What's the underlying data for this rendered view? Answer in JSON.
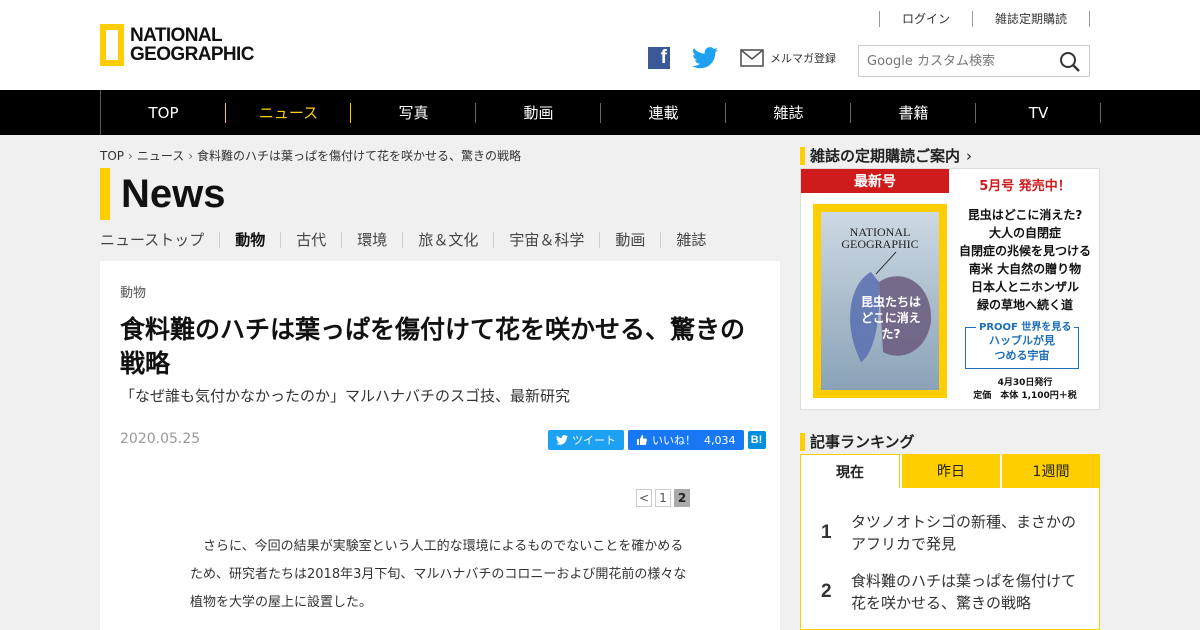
{
  "header": {
    "logo": {
      "line1": "NATIONAL",
      "line2": "GEOGRAPHIC"
    },
    "top_links": [
      "ログイン",
      "雑誌定期購読"
    ],
    "newsletter_label": "メルマガ登録",
    "search_placeholder": "Google カスタム検索",
    "brand_color": "#ffce00"
  },
  "nav": {
    "items": [
      "TOP",
      "ニュース",
      "写真",
      "動画",
      "連載",
      "雑誌",
      "書籍",
      "TV"
    ],
    "active": "ニュース"
  },
  "breadcrumb": [
    "TOP",
    "ニュース",
    "食料難のハチは葉っぱを傷付けて花を咲かせる、驚きの戦略"
  ],
  "section": {
    "title": "News"
  },
  "subnav": {
    "items": [
      "ニューストップ",
      "動物",
      "古代",
      "環境",
      "旅＆文化",
      "宇宙＆科学",
      "動画",
      "雑誌"
    ],
    "active": "動物"
  },
  "article": {
    "category": "動物",
    "headline": "食料難のハチは葉っぱを傷付けて花を咲かせる、驚きの戦略",
    "subtitle": "「なぜ誰も気付かなかったのか」マルハナバチのスゴ技、最新研究",
    "date": "2020.05.25",
    "share": {
      "tweet": "ツイート",
      "like": "いいね！",
      "like_count": "4,034",
      "hatena": "B!"
    },
    "pager": {
      "prev": "<",
      "pages": [
        "1",
        "2"
      ],
      "current": "2"
    },
    "body": "さらに、今回の結果が実験室という人工的な環境によるものでないことを確かめるため、研究者たちは2018年3月下旬、マルハナバチのコロニーおよび開花前の様々な植物を大学の屋上に設置した。"
  },
  "sidebar": {
    "magazine": {
      "heading": "雑誌の定期購読ご案内",
      "latest_label": "最新号",
      "issue_label": "5月号 発売中！",
      "cover_brand": "NATIONAL GEOGRAPHIC",
      "cover_title": "昆虫たちはどこに消えた?",
      "features": [
        "昆虫はどこに消えた?",
        "大人の自閉症",
        "自閉症の兆候を見つける",
        "南米 大自然の贈り物",
        "日本人とニホンザル",
        "緑の草地へ続く道"
      ],
      "proof_label": "PROOF 世界を見る",
      "proof_title": "ハッブルが見つめる宇宙",
      "release": "4月30日発行",
      "price": "定価　本体 1,100円＋税"
    },
    "ranking": {
      "heading": "記事ランキング",
      "tabs": [
        "現在",
        "昨日",
        "1週間"
      ],
      "active_tab": "現在",
      "items": [
        {
          "rank": "1",
          "title": "タツノオトシゴの新種、まさかのアフリカで発見"
        },
        {
          "rank": "2",
          "title": "食料難のハチは葉っぱを傷付けて花を咲かせる、驚きの戦略"
        }
      ]
    }
  }
}
